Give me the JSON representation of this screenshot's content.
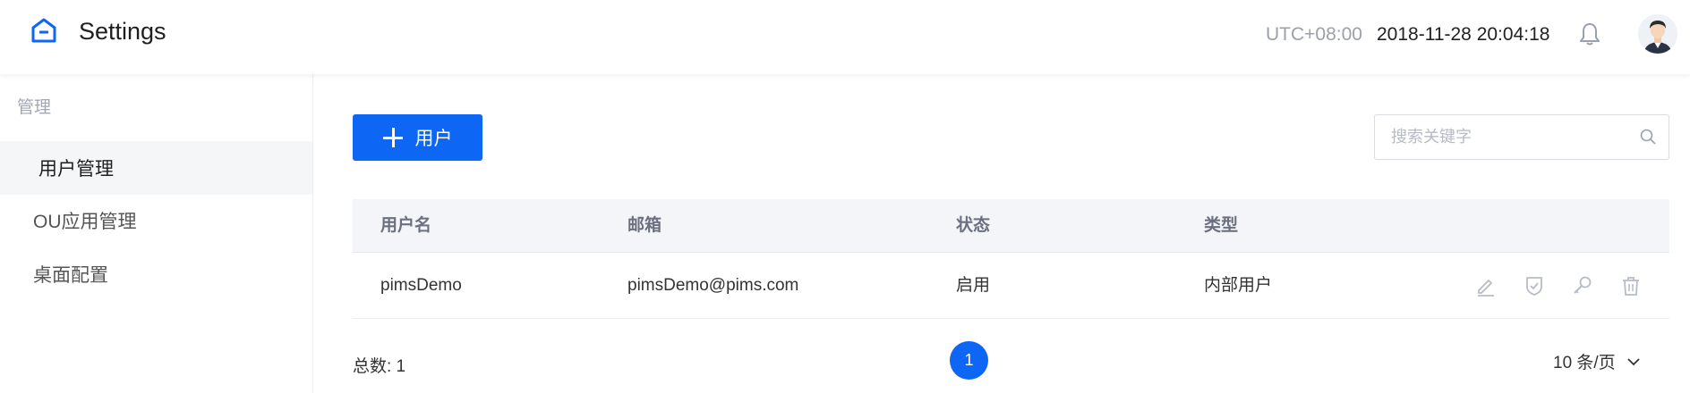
{
  "header": {
    "title": "Settings",
    "timezone": "UTC+08:00",
    "datetime": "2018-11-28 20:04:18",
    "icons": {
      "logo": "home-outline-icon",
      "bell": "bell-icon",
      "avatar": "user-avatar"
    }
  },
  "sidebar": {
    "group_label": "管理",
    "items": [
      {
        "label": "用户管理",
        "active": true
      },
      {
        "label": "OU应用管理",
        "active": false
      },
      {
        "label": "桌面配置",
        "active": false
      }
    ]
  },
  "toolbar": {
    "add_label": "用户",
    "search_placeholder": "搜索关键字"
  },
  "table": {
    "columns": [
      "用户名",
      "邮箱",
      "状态",
      "类型"
    ],
    "rows": [
      {
        "username": "pimsDemo",
        "email": "pimsDemo@pims.com",
        "status": "启用",
        "type": "内部用户",
        "actions": [
          "edit-icon",
          "shield-check-icon",
          "key-icon",
          "delete-icon"
        ]
      }
    ]
  },
  "pagination": {
    "total_label": "总数: 1",
    "current_page": "1",
    "page_size": "10 条/页"
  },
  "colors": {
    "primary": "#0e66f5",
    "header_bg": "#ffffff",
    "table_header_bg": "#f4f5f8",
    "sidebar_active_bg": "#f5f6f8",
    "muted_text": "#9aa0ad"
  }
}
